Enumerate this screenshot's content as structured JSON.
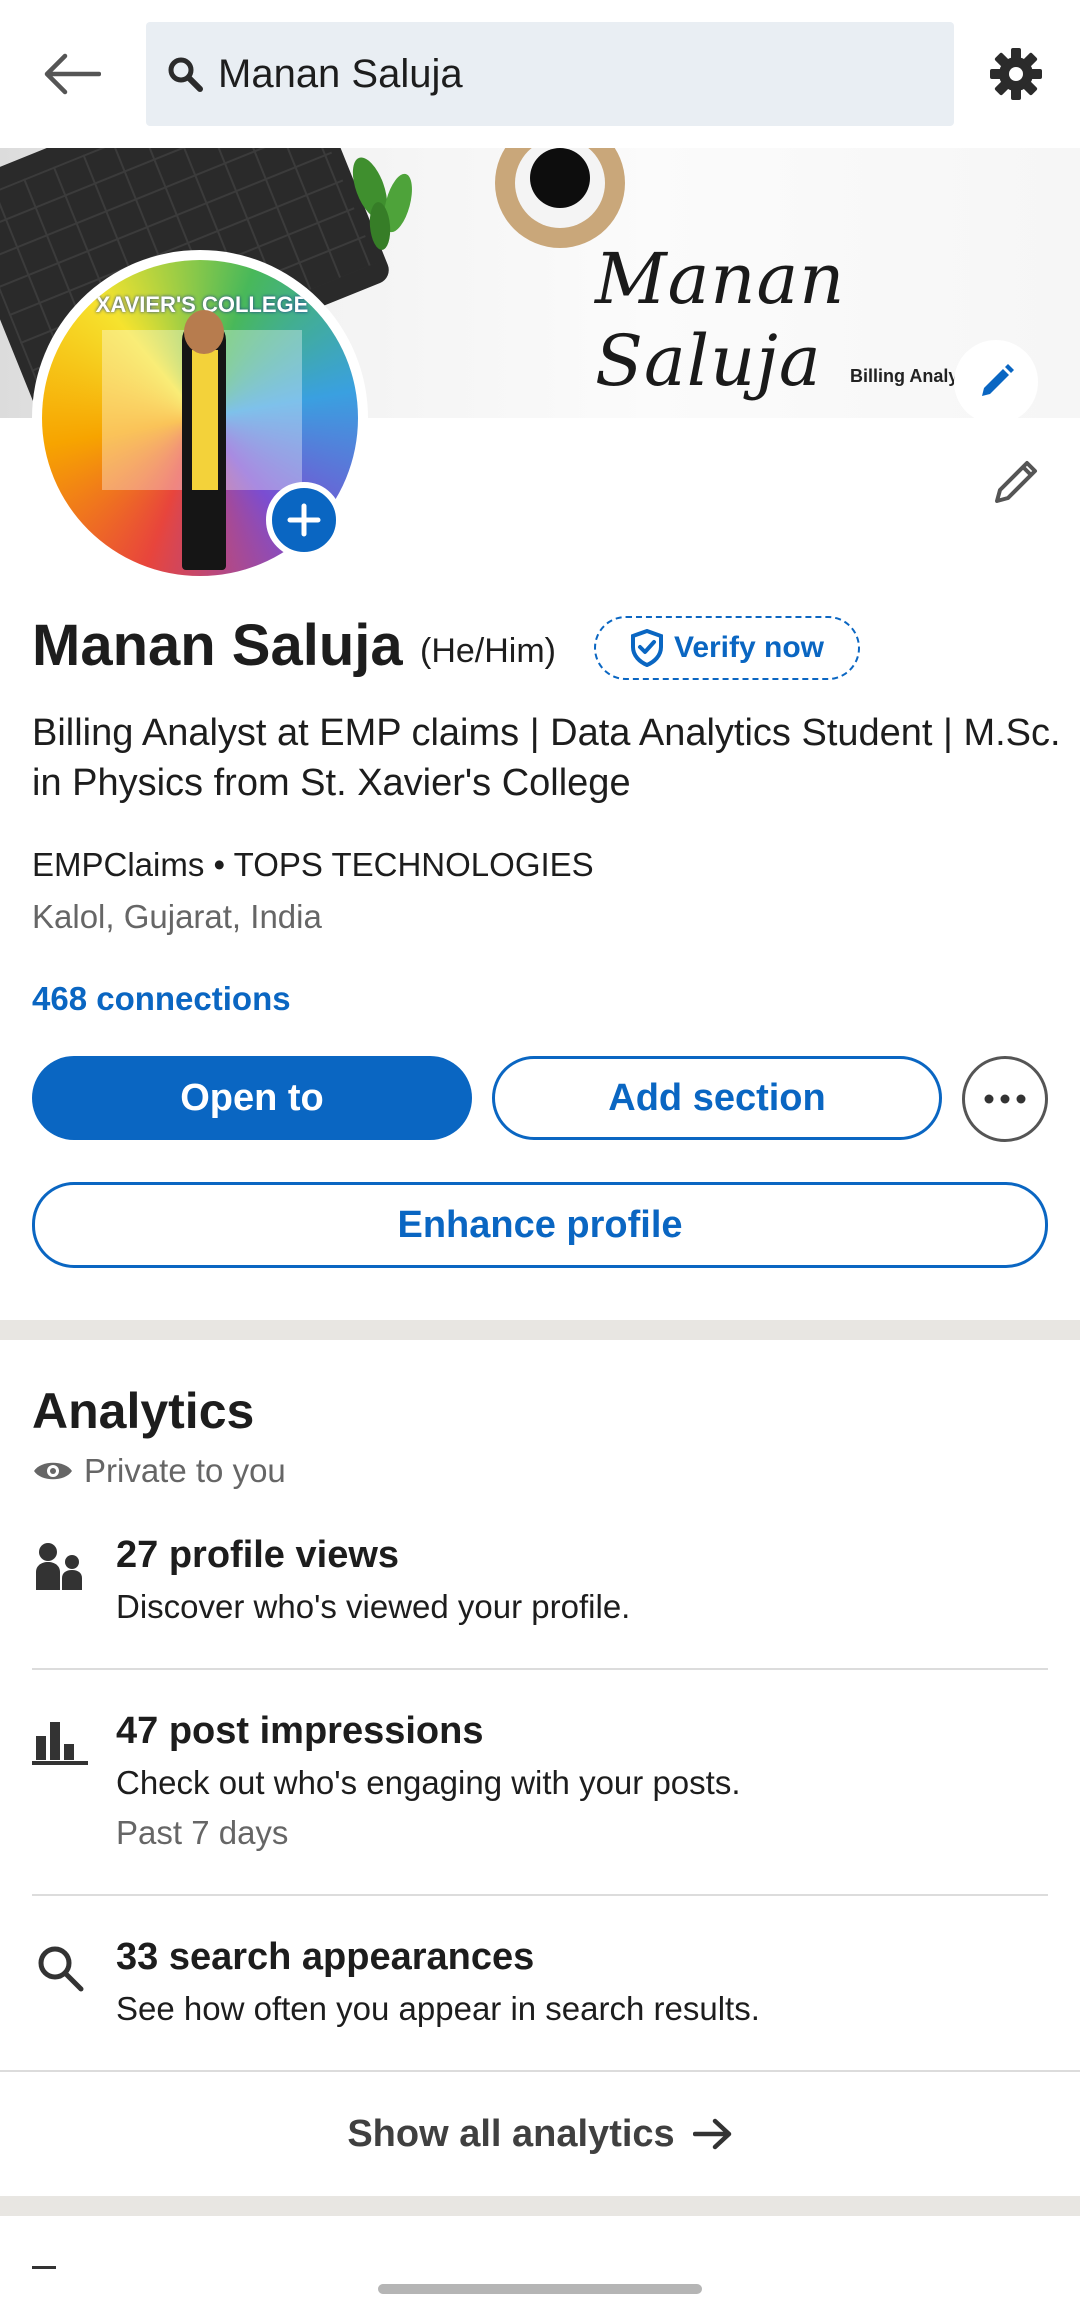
{
  "search": {
    "query": "Manan Saluja"
  },
  "banner": {
    "signature": "Manan Saluja",
    "subtitle": "Billing Analyst"
  },
  "avatar": {
    "banner_text": "XAVIER'S COLLEGE"
  },
  "profile": {
    "name": "Manan Saluja",
    "pronouns": "(He/Him)",
    "verify_label": "Verify now",
    "headline": "Billing Analyst at EMP claims | Data Analytics Student | M.Sc. in Physics from St. Xavier's College",
    "company": "EMPClaims • TOPS TECHNOLOGIES",
    "location": "Kalol, Gujarat, India",
    "connections": "468 connections"
  },
  "actions": {
    "open_to": "Open to",
    "add_section": "Add section",
    "enhance_profile": "Enhance profile"
  },
  "analytics": {
    "title": "Analytics",
    "private_label": "Private to you",
    "items": [
      {
        "icon": "people-icon",
        "title": "27 profile views",
        "description": "Discover who's viewed your profile.",
        "sub": ""
      },
      {
        "icon": "bar-chart-icon",
        "title": "47 post impressions",
        "description": "Check out who's engaging with your posts.",
        "sub": "Past 7 days"
      },
      {
        "icon": "search-icon",
        "title": "33 search appearances",
        "description": "See how often you appear in search results.",
        "sub": ""
      }
    ],
    "show_all": "Show all analytics"
  },
  "colors": {
    "accent": "#0a66c2",
    "divider": "#e8e6e2",
    "muted_text": "#666666"
  }
}
